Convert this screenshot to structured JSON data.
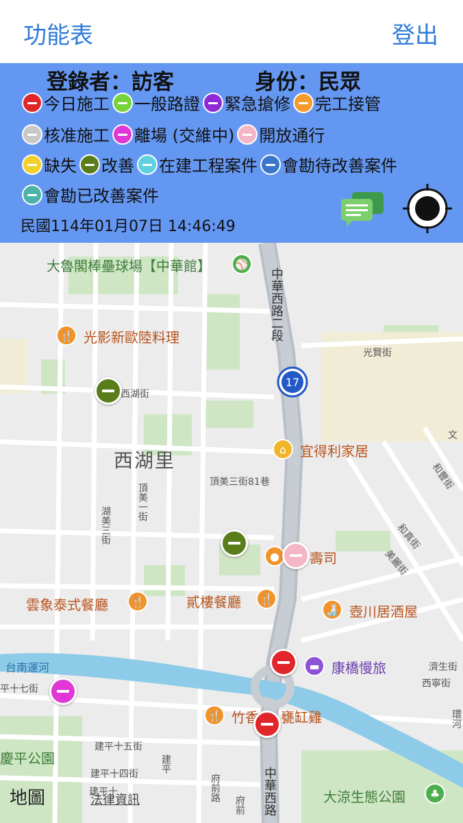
{
  "topbar": {
    "menu_label": "功能表",
    "logout_label": "登出"
  },
  "panel": {
    "user_label": "登錄者：訪客",
    "role_label": "身份：民眾",
    "timestamp": "民國114年01月07日 14:46:49",
    "legend": [
      {
        "label": "今日施工",
        "color": "#e0252b"
      },
      {
        "label": "一般路證",
        "color": "#78d23c"
      },
      {
        "label": "緊急搶修",
        "color": "#8e2bd6"
      },
      {
        "label": "完工接管",
        "color": "#f39b2c"
      },
      {
        "label": "核准施工",
        "color": "#c9c9c9"
      },
      {
        "label": "離場 (交維中)",
        "color": "#e037d6"
      },
      {
        "label": "開放通行",
        "color": "#f4b6c7"
      },
      {
        "label": "缺失",
        "color": "#f2d02a"
      },
      {
        "label": "改善",
        "color": "#5a7d1c"
      },
      {
        "label": "在建工程案件",
        "color": "#5fd0df"
      },
      {
        "label": "會勘待改善案件",
        "color": "#3a76c9"
      },
      {
        "label": "會勘已改善案件",
        "color": "#4cb3a8"
      }
    ]
  },
  "map": {
    "district": "西湖里",
    "route_number": "17",
    "pois": {
      "stadium": "大魯閣棒壘球場【中華館】",
      "restaurant1": "光影新歐陸料理",
      "store": "宜得利家居",
      "sushi": "壽司",
      "thai": "雲象泰式餐廳",
      "restaurant2": "貳樓餐廳",
      "izakaya": "壺川居酒屋",
      "hotel": "康橋慢旅",
      "chicken": "竹香",
      "chicken2": "甕缸雞",
      "park1": "慶平公園",
      "park2": "大涼生態公園"
    },
    "streets": {
      "zhonghua_west_2": "中華西路二段",
      "guangxian": "光賢街",
      "xihu": "西湖街",
      "dingmei_81": "頂美三街81巷",
      "dingmei_1": "頂美一街",
      "humei_3": "湖美三街",
      "canal": "台南運河",
      "ping17": "平十七街",
      "jianping15": "建平十五街",
      "jianping14": "建平十四街",
      "jianping13": "建平十",
      "jianping_pei": "建平",
      "jianping_vert": "建平十",
      "fuqian": "府前路",
      "fuqian2": "府前",
      "zhonghua_west": "中華西路",
      "hezhen": "和真街",
      "meili": "美麗街",
      "jisheng": "濟生街",
      "xining": "西寧街",
      "huan": "環河",
      "hefeng": "和豐街",
      "wen": "文"
    },
    "attribution": "地圖",
    "legal": "法律資訊"
  }
}
